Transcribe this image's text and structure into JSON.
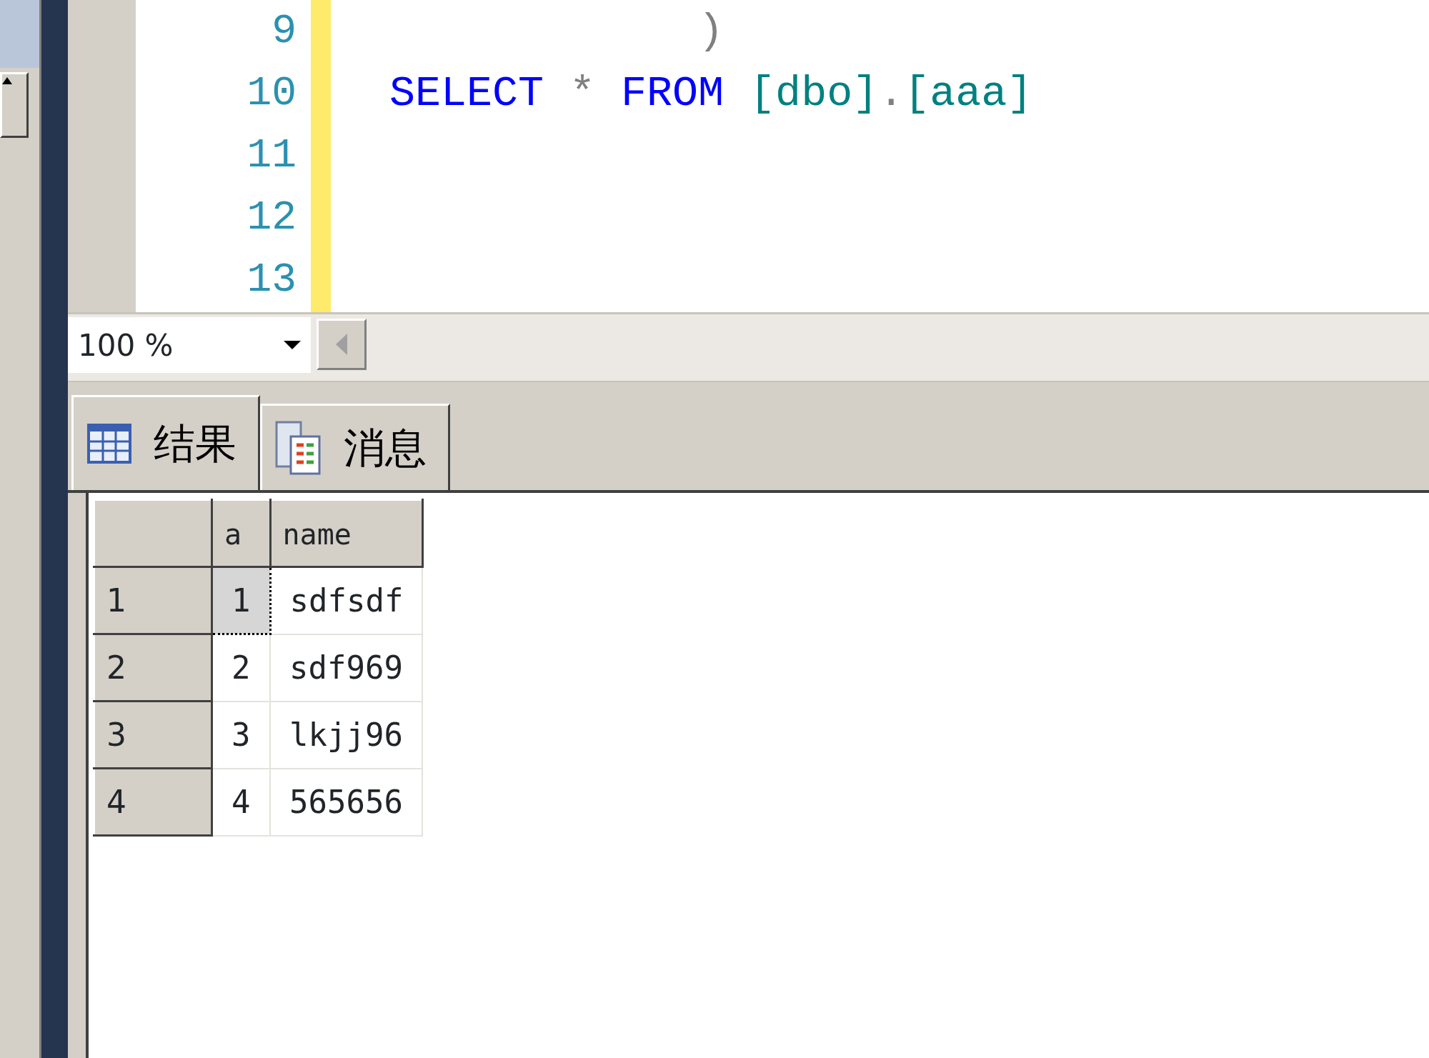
{
  "editor": {
    "lines": [
      {
        "number": "9",
        "tokens": [
          {
            "kind": "punct",
            "text": "            )"
          }
        ]
      },
      {
        "number": "10",
        "tokens": [
          {
            "kind": "keyword",
            "text": "SELECT"
          },
          {
            "kind": "operator",
            "text": " * "
          },
          {
            "kind": "keyword",
            "text": "FROM"
          },
          {
            "kind": "identifier",
            "text": " [dbo]"
          },
          {
            "kind": "operator",
            "text": "."
          },
          {
            "kind": "identifier",
            "text": "[aaa]"
          }
        ]
      },
      {
        "number": "11"
      },
      {
        "number": "12"
      },
      {
        "number": "13"
      }
    ]
  },
  "zoom": {
    "value": "100 %"
  },
  "result_tabs": [
    {
      "label": "结果",
      "selected": true
    },
    {
      "label": "消息",
      "selected": false
    }
  ],
  "grid": {
    "columns": [
      "a",
      "name"
    ],
    "rows": [
      {
        "number": "1",
        "cells": [
          {
            "text": "1",
            "selected": true
          },
          {
            "text": "sdfsdf",
            "selected": false
          }
        ]
      },
      {
        "number": "2",
        "cells": [
          {
            "text": "2",
            "selected": false
          },
          {
            "text": "sdf969",
            "selected": false
          }
        ]
      },
      {
        "number": "3",
        "cells": [
          {
            "text": "3",
            "selected": false
          },
          {
            "text": "lkjj96",
            "selected": false
          }
        ]
      },
      {
        "number": "4",
        "cells": [
          {
            "text": "4",
            "selected": false
          },
          {
            "text": "565656",
            "selected": false
          }
        ]
      }
    ]
  }
}
